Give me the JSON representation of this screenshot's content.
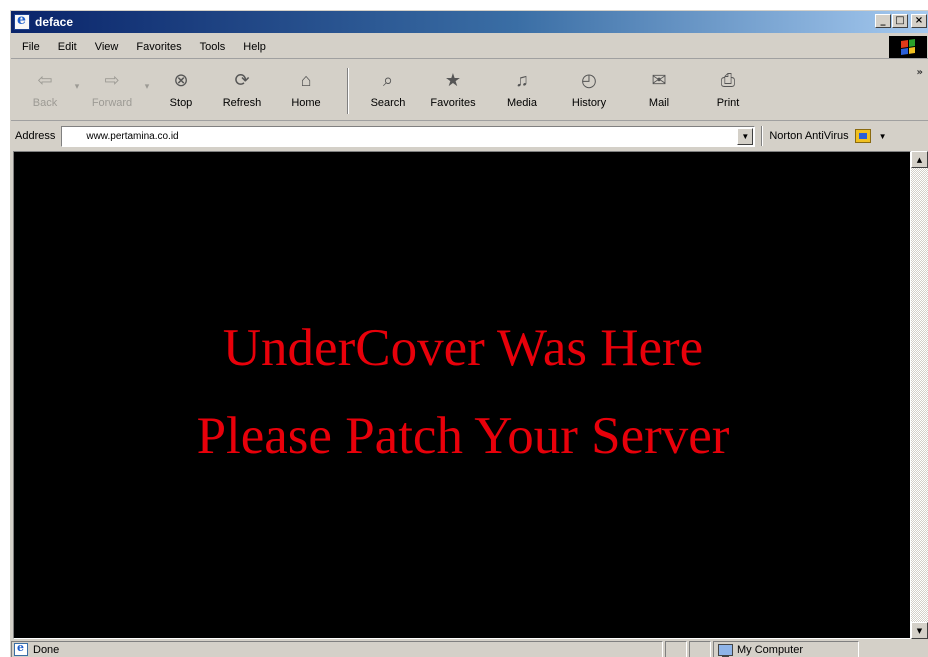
{
  "window": {
    "title": "deface",
    "buttons": {
      "minimize": "_",
      "maximize": "□",
      "close": "×"
    }
  },
  "menu": [
    "File",
    "Edit",
    "View",
    "Favorites",
    "Tools",
    "Help"
  ],
  "toolbar": {
    "buttons": [
      {
        "label": "Back",
        "icon": "back-arrow-icon",
        "enabled": false
      },
      {
        "label": "Forward",
        "icon": "forward-arrow-icon",
        "enabled": false
      },
      {
        "label": "Stop",
        "icon": "stop-icon",
        "enabled": true
      },
      {
        "label": "Refresh",
        "icon": "refresh-icon",
        "enabled": true
      },
      {
        "label": "Home",
        "icon": "home-icon",
        "enabled": true
      },
      {
        "label": "Search",
        "icon": "search-icon",
        "enabled": true
      },
      {
        "label": "Favorites",
        "icon": "favorites-icon",
        "enabled": true
      },
      {
        "label": "Media",
        "icon": "media-icon",
        "enabled": true
      },
      {
        "label": "History",
        "icon": "history-icon",
        "enabled": true
      },
      {
        "label": "Mail",
        "icon": "mail-icon",
        "enabled": true
      },
      {
        "label": "Print",
        "icon": "print-icon",
        "enabled": true
      }
    ],
    "chevron": "»"
  },
  "address": {
    "label": "Address",
    "url": "www.pertamina.co.id",
    "norton_label": "Norton AntiVirus"
  },
  "content": {
    "line1": "UnderCover Was Here",
    "line2": "Please Patch Your Server",
    "text_color": "#e8000a",
    "background": "#000000"
  },
  "status": {
    "text": "Done",
    "zone": "My Computer"
  }
}
